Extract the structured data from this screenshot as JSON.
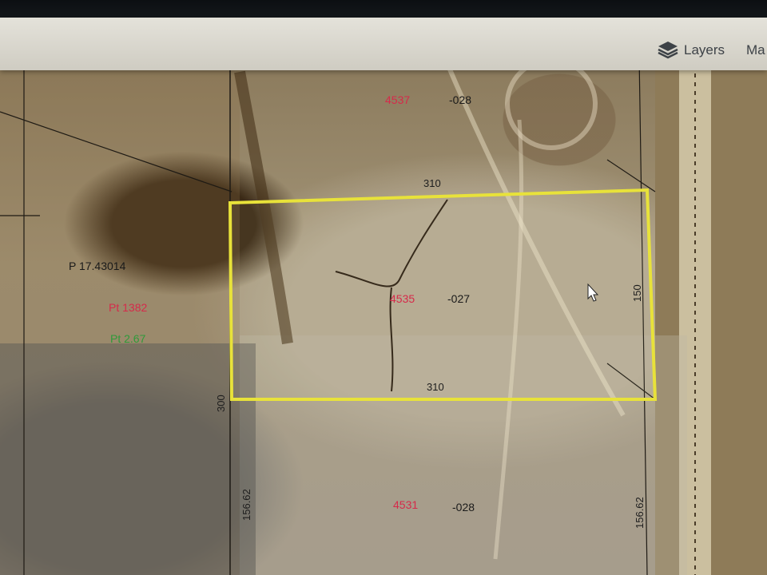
{
  "toolbar": {
    "layers_label": "Layers",
    "maps_label": "Ma",
    "icons": {
      "layers": "layers-icon"
    }
  },
  "map": {
    "parcels": [
      {
        "id": "north",
        "number": "4537",
        "code": "-028"
      },
      {
        "id": "selected",
        "number": "4535",
        "code": "-027",
        "selected": true
      },
      {
        "id": "south",
        "number": "4531",
        "code": "-028"
      }
    ],
    "dimensions": {
      "top_edge": "310",
      "bottom_edge": "310",
      "right_edge": "150",
      "left_line": "300",
      "lower_left": "156.62",
      "lower_right": "156.62"
    },
    "side_labels": {
      "pt1": "Pt 1382",
      "pt2": "Pt 2.67",
      "partial": "P 17.43014"
    },
    "colors": {
      "selection": "#e8e23a",
      "parcel_number": "#d62a4a",
      "pt_green": "#2f9a3a"
    }
  }
}
